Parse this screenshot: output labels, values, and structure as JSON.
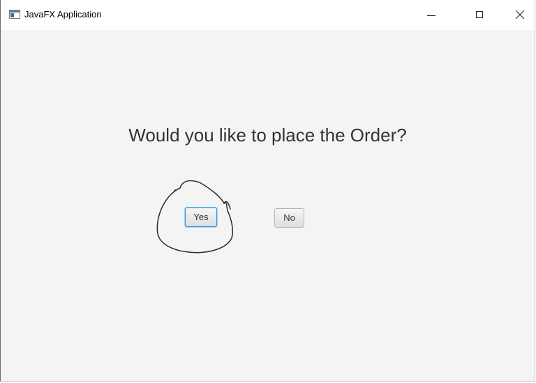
{
  "window": {
    "title": "JavaFX Application",
    "icon": "app-window-icon",
    "controls": [
      "minimize-icon",
      "maximize-icon",
      "close-icon"
    ],
    "background": "#f4f4f4"
  },
  "dialog": {
    "question": "Would you like to place the Order?",
    "buttons": {
      "yes": "Yes",
      "no": "No"
    },
    "focused_button": "yes",
    "focus_color": "#2f8fd6"
  },
  "annotation": {
    "type": "hand-drawn-circle",
    "target": "yes-button",
    "color": "#2a2a2a"
  }
}
